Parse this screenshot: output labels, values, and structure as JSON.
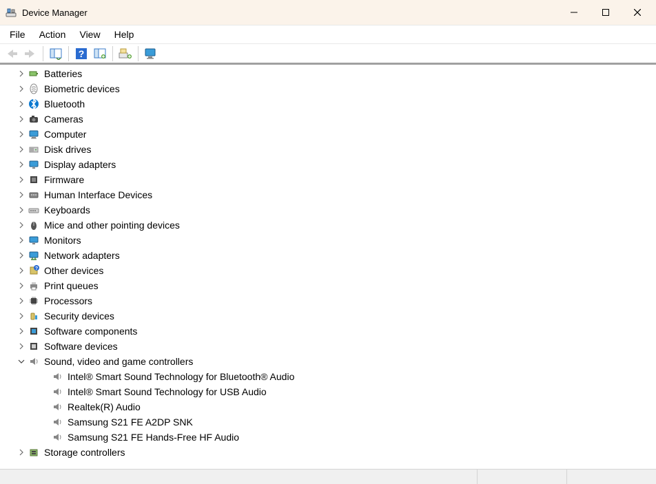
{
  "window": {
    "title": "Device Manager"
  },
  "menu": {
    "file": "File",
    "action": "Action",
    "view": "View",
    "help": "Help"
  },
  "categories": [
    {
      "icon": "battery",
      "label": "Batteries"
    },
    {
      "icon": "biometric",
      "label": "Biometric devices"
    },
    {
      "icon": "bluetooth",
      "label": "Bluetooth"
    },
    {
      "icon": "camera",
      "label": "Cameras"
    },
    {
      "icon": "computer",
      "label": "Computer"
    },
    {
      "icon": "disk",
      "label": "Disk drives"
    },
    {
      "icon": "display",
      "label": "Display adapters"
    },
    {
      "icon": "firmware",
      "label": "Firmware"
    },
    {
      "icon": "hid",
      "label": "Human Interface Devices"
    },
    {
      "icon": "keyboard",
      "label": "Keyboards"
    },
    {
      "icon": "mouse",
      "label": "Mice and other pointing devices"
    },
    {
      "icon": "monitor",
      "label": "Monitors"
    },
    {
      "icon": "network",
      "label": "Network adapters"
    },
    {
      "icon": "other",
      "label": "Other devices"
    },
    {
      "icon": "printer",
      "label": "Print queues"
    },
    {
      "icon": "processor",
      "label": "Processors"
    },
    {
      "icon": "security",
      "label": "Security devices"
    },
    {
      "icon": "software",
      "label": "Software components"
    },
    {
      "icon": "swdev",
      "label": "Software devices"
    }
  ],
  "sound": {
    "label": "Sound, video and game controllers",
    "children": [
      "Intel® Smart Sound Technology for Bluetooth® Audio",
      "Intel® Smart Sound Technology for USB Audio",
      "Realtek(R) Audio",
      "Samsung S21 FE A2DP SNK",
      "Samsung S21 FE Hands-Free HF Audio"
    ]
  },
  "last": {
    "label": "Storage controllers"
  }
}
